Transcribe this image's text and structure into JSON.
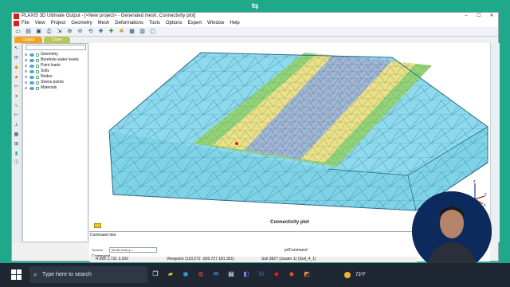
{
  "window": {
    "title": "PLAXIS 3D Ultimate Output - [<New project> - Generated mesh, Connectivity plot]",
    "controls": [
      "–",
      "☐",
      "✕"
    ]
  },
  "menubar": [
    "File",
    "View",
    "Project",
    "Geometry",
    "Mesh",
    "Deformations",
    "Tools",
    "Options",
    "Expert",
    "Window",
    "Help"
  ],
  "tabs": [
    {
      "label": "Output"
    },
    {
      "label": "Close"
    }
  ],
  "explorer": {
    "items": [
      {
        "label": "Geometry"
      },
      {
        "label": "Borehole water levels"
      },
      {
        "label": "Point loads"
      },
      {
        "label": "Soils"
      },
      {
        "label": "Nodes"
      },
      {
        "label": "Stress points"
      },
      {
        "label": "Materials"
      }
    ]
  },
  "viewport": {
    "plot_title": "Connectivity plot",
    "axes": {
      "z": "z",
      "y": "y",
      "x": "x"
    }
  },
  "command": {
    "label": "Command line:",
    "session_label": "Session",
    "session_value": "Model history >",
    "prompt_label": "Command",
    "last_command": "prlCommand"
  },
  "status": {
    "coords": "-4.905 1.731 2.200",
    "viewpoint": "Viewpoint (133.272 -208.727 181.351)",
    "soil": "Soil 3827 (cluster 1) (Soil_4_1)"
  },
  "taskbar": {
    "search_placeholder": "Type here to search",
    "weather": "73°F"
  },
  "colors": {
    "accent_tab": "#f4a31d",
    "mesh_outer": "#7fd3e6",
    "mesh_green": "#8fd47a",
    "mesh_yellow": "#e9e08a",
    "mesh_center": "#9fb8d6",
    "desktop": "#1fa98a"
  }
}
